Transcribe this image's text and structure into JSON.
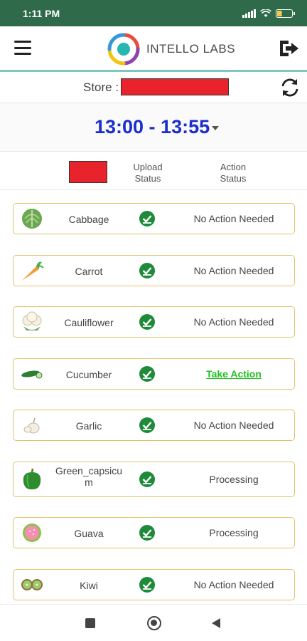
{
  "status_bar": {
    "time": "1:11 PM",
    "battery": "31"
  },
  "header": {
    "logo_text": "INTELLO LABS"
  },
  "store": {
    "label": "Store :"
  },
  "time_filter": {
    "range": "13:00 - 13:55"
  },
  "columns": {
    "upload_status": "Upload Status",
    "action_status": "Action Status"
  },
  "items": [
    {
      "name": "Cabbage",
      "status": "No Action Needed",
      "icon": "cabbage-icon"
    },
    {
      "name": "Carrot",
      "status": "No Action Needed",
      "icon": "carrot-icon"
    },
    {
      "name": "Cauliflower",
      "status": "No Action Needed",
      "icon": "cauliflower-icon"
    },
    {
      "name": "Cucumber",
      "status": "Take Action",
      "icon": "cucumber-icon"
    },
    {
      "name": "Garlic",
      "status": "No Action Needed",
      "icon": "garlic-icon"
    },
    {
      "name": "Green_capsicum",
      "status": "Processing",
      "icon": "green-capsicum-icon"
    },
    {
      "name": "Guava",
      "status": "Processing",
      "icon": "guava-icon"
    },
    {
      "name": "Kiwi",
      "status": "No Action Needed",
      "icon": "kiwi-icon"
    }
  ],
  "colors": {
    "status_bar": "#2f6b4b",
    "time_accent": "#1a2ecc",
    "row_border": "#e2c36b",
    "check_green": "#1f8a3a",
    "take_action": "#1ec11e",
    "redaction": "#e8232c",
    "header_underline": "#7fc6c3"
  }
}
